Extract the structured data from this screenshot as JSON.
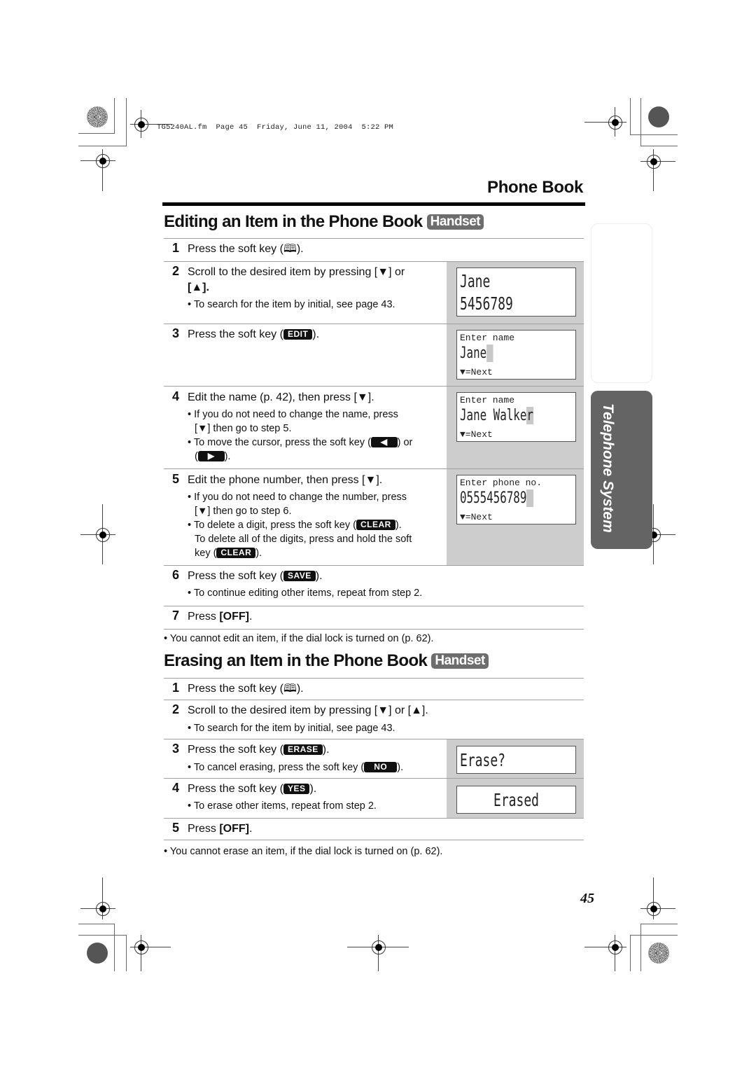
{
  "print_header": "TG5240AL.fm  Page 45  Friday, June 11, 2004  5:22 PM",
  "page_title": "Phone Book",
  "side_tab": "Telephone System",
  "page_number": "45",
  "editing": {
    "title": "Editing an Item in the Phone Book",
    "badge": "Handset",
    "steps": [
      {
        "num": "1",
        "pre": "Press the soft key (",
        "icon": "phonebook-icon",
        "post": ")."
      },
      {
        "num": "2",
        "line1": "Scroll to the desired item by pressing [▼] or",
        "line2": "[▲].",
        "bullets": [
          "To search for the item by initial, see page 43."
        ]
      },
      {
        "num": "3",
        "pre": "Press the soft key (",
        "key": "EDIT",
        "post": ")."
      },
      {
        "num": "4",
        "text": "Edit the name (p. 42), then press [▼].",
        "bullets": [
          "If you do not need to change the name, press",
          "[▼] then go to step 5.",
          "To move the cursor, press the soft key (",
          ") or",
          "(",
          ")."
        ]
      },
      {
        "num": "5",
        "text": "Edit the phone number, then press [▼].",
        "bullets": [
          "If you do not need to change the number, press",
          "[▼] then go to step 6.",
          "To delete a digit, press the soft key (",
          ").",
          "To delete all of the digits, press and hold the soft",
          "key (",
          ")."
        ],
        "key": "CLEAR"
      },
      {
        "num": "6",
        "pre": "Press the soft key (",
        "key": "SAVE",
        "post": ").",
        "bullets": [
          "To continue editing other items, repeat from step 2."
        ]
      },
      {
        "num": "7",
        "pre": "Press ",
        "bold": "[OFF]",
        "post": "."
      }
    ],
    "note": "You cannot edit an item, if the dial lock is turned on (p. 62).",
    "displays": [
      {
        "line1": "Jane",
        "line2": "5456789"
      },
      {
        "label": "Enter name",
        "value": "Jane",
        "hint": "▼=Next"
      },
      {
        "label": "Enter name",
        "value": "Jane Walke",
        "cursor_char": "r",
        "hint": "▼=Next"
      },
      {
        "label": "Enter phone no.",
        "value": "0555456789",
        "hint": "▼=Next"
      }
    ]
  },
  "erasing": {
    "title": "Erasing an Item in the Phone Book",
    "badge": "Handset",
    "steps": [
      {
        "num": "1",
        "pre": "Press the soft key (",
        "icon": "phonebook-icon",
        "post": ")."
      },
      {
        "num": "2",
        "text": "Scroll to the desired item by pressing [▼] or [▲].",
        "bullets": [
          "To search for the item by initial, see page 43."
        ]
      },
      {
        "num": "3",
        "pre": "Press the soft key (",
        "key": "ERASE",
        "post": ").",
        "bullets": [
          "To cancel erasing, press the soft key (",
          ")."
        ],
        "bullet_key": "NO"
      },
      {
        "num": "4",
        "pre": "Press the soft key (",
        "key": "YES",
        "post": ").",
        "bullets": [
          "To erase other items, repeat from step 2."
        ]
      },
      {
        "num": "5",
        "pre": "Press ",
        "bold": "[OFF]",
        "post": "."
      }
    ],
    "note": "You cannot erase an item, if the dial lock is turned on (p. 62).",
    "displays": [
      {
        "text": "Erase?"
      },
      {
        "text": "Erased"
      }
    ]
  }
}
